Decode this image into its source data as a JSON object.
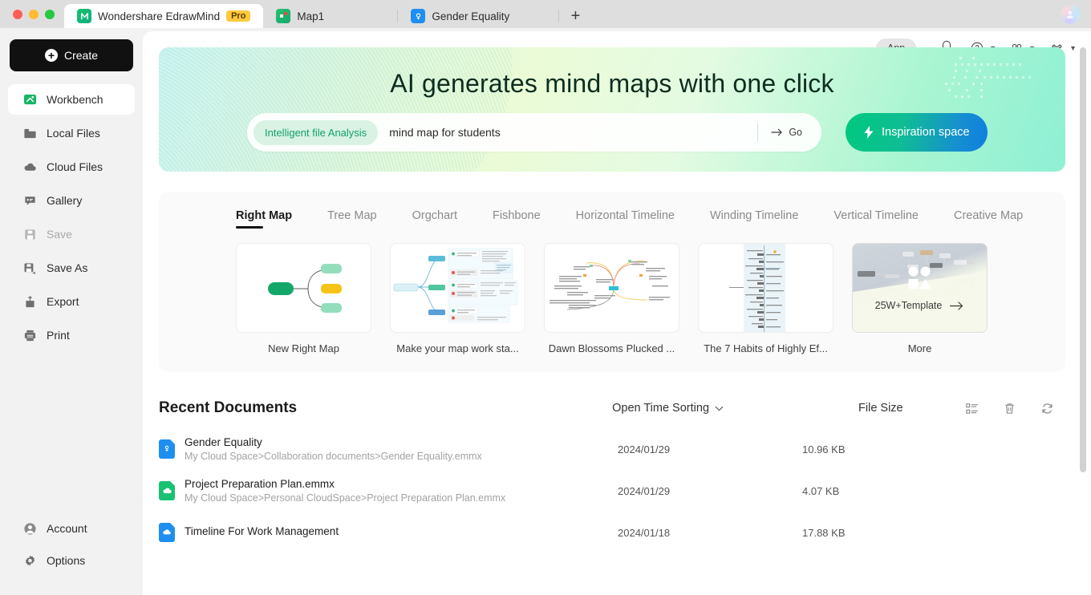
{
  "window": {
    "tabs": [
      {
        "label": "Wondershare EdrawMind",
        "badge": "Pro",
        "icon": "edrawmind-icon",
        "active": true
      },
      {
        "label": "Map1",
        "icon": "map-pin-icon",
        "active": false
      },
      {
        "label": "Gender Equality",
        "icon": "document-icon",
        "active": false
      }
    ],
    "new_tab_label": "+",
    "avatar_name": "user-avatar"
  },
  "topbar": {
    "app_label": "App",
    "icons": [
      "bell-icon",
      "help-circle-icon",
      "grid-apps-icon",
      "theme-shirt-icon"
    ]
  },
  "sidebar": {
    "create_label": "Create",
    "items": [
      {
        "label": "Workbench",
        "icon": "workbench-icon",
        "active": true,
        "disabled": false
      },
      {
        "label": "Local Files",
        "icon": "folder-icon",
        "active": false,
        "disabled": false
      },
      {
        "label": "Cloud Files",
        "icon": "cloud-icon",
        "active": false,
        "disabled": false
      },
      {
        "label": "Gallery",
        "icon": "gallery-icon",
        "active": false,
        "disabled": false
      },
      {
        "label": "Save",
        "icon": "save-icon",
        "active": false,
        "disabled": true
      },
      {
        "label": "Save As",
        "icon": "save-as-icon",
        "active": false,
        "disabled": false
      },
      {
        "label": "Export",
        "icon": "export-icon",
        "active": false,
        "disabled": false
      },
      {
        "label": "Print",
        "icon": "print-icon",
        "active": false,
        "disabled": false
      }
    ],
    "bottom_items": [
      {
        "label": "Account",
        "icon": "account-icon"
      },
      {
        "label": "Options",
        "icon": "gear-icon"
      }
    ]
  },
  "banner": {
    "title": "AI generates mind maps with one click",
    "chip_label": "Intelligent file Analysis",
    "search_value": "mind map for students",
    "search_placeholder": "mind map for students",
    "go_label": "Go",
    "inspiration_label": "Inspiration space",
    "gradient_from": "#ccf3f1",
    "gradient_to": "#8ef0d4",
    "button_gradient_from": "#00c97f",
    "button_gradient_to": "#0f7ee0",
    "chip_color": "#12a06b"
  },
  "templates": {
    "tabs": [
      {
        "label": "Right Map",
        "active": true
      },
      {
        "label": "Tree Map",
        "active": false
      },
      {
        "label": "Orgchart",
        "active": false
      },
      {
        "label": "Fishbone",
        "active": false
      },
      {
        "label": "Horizontal Timeline",
        "active": false
      },
      {
        "label": "Winding Timeline",
        "active": false
      },
      {
        "label": "Vertical Timeline",
        "active": false
      },
      {
        "label": "Creative Map",
        "active": false
      }
    ],
    "items": [
      {
        "name": "New Right Map",
        "kind": "new-right-map"
      },
      {
        "name": "Make your map work sta...",
        "kind": "detailed-map"
      },
      {
        "name": "Dawn Blossoms Plucked ...",
        "kind": "dense-map"
      },
      {
        "name": "The 7 Habits of Highly Ef...",
        "kind": "timeline-map"
      },
      {
        "name": "More",
        "kind": "more",
        "overlay_label": "25W+Template"
      }
    ]
  },
  "recent": {
    "title": "Recent Documents",
    "sort_label": "Open Time Sorting",
    "size_header": "File Size",
    "action_icons": [
      "list-view-icon",
      "trash-icon",
      "refresh-icon"
    ],
    "rows": [
      {
        "name": "Gender Equality",
        "path": "My Cloud Space>Collaboration documents>Gender Equality.emmx",
        "date": "2024/01/29",
        "size": "10.96 KB",
        "icon_color": "#1e8ff0"
      },
      {
        "name": "Project Preparation Plan.emmx",
        "path": "My Cloud Space>Personal CloudSpace>Project Preparation Plan.emmx",
        "date": "2024/01/29",
        "size": "4.07 KB",
        "icon_color": "#19c271"
      },
      {
        "name": "Timeline For Work Management",
        "path": "",
        "date": "2024/01/18",
        "size": "17.88 KB",
        "icon_color": "#1e8ff0"
      }
    ]
  }
}
